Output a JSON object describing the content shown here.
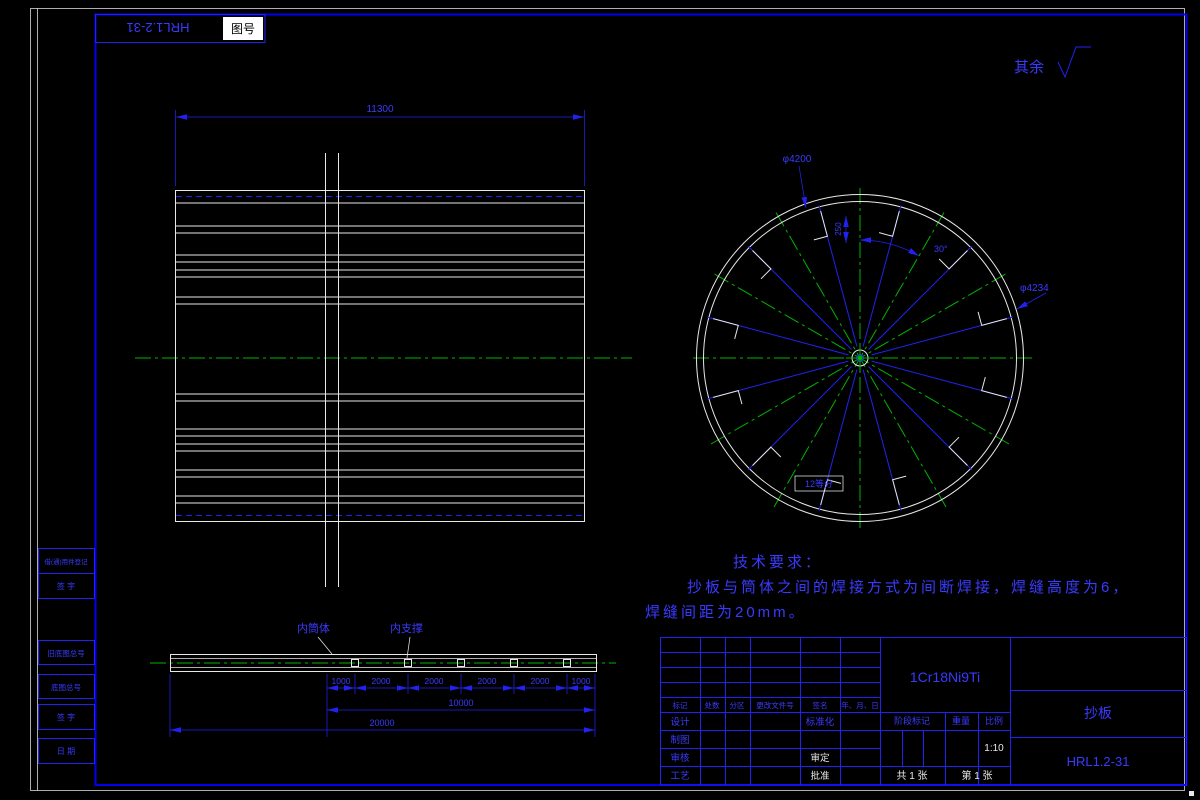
{
  "top_left": {
    "drawing_no": "HRL1.2-31",
    "box_label": "图号"
  },
  "top_right": {
    "note": "其余"
  },
  "main_view": {
    "width_dim": "11300"
  },
  "circle_view": {
    "dia_inner": "φ4200",
    "dia_outer": "φ4234",
    "angle": "30°",
    "plate_dim": "250",
    "note": "12等分"
  },
  "bottom_view": {
    "label_shell": "内筒体",
    "label_support": "内支撑",
    "seg_dims": [
      "1000",
      "2000",
      "2000",
      "2000",
      "2000",
      "1000"
    ],
    "mid_dim": "10000",
    "total_dim": "20000"
  },
  "tech_req": {
    "title": "技术要求：",
    "line1": "抄板与筒体之间的焊接方式为间断焊接，焊缝高度为6，",
    "line2": "焊缝间距为20mm。"
  },
  "title_block": {
    "material": "1Cr18Ni9Ti",
    "part_name": "抄板",
    "drawing_no": "HRL1.2-31",
    "stage_label": "阶段标记",
    "weight_label": "重量",
    "scale_label": "比例",
    "scale_value": "1:10",
    "sheet_total": "共 1 张",
    "sheet_no": "第 1 张",
    "header_cells": [
      "标记",
      "处数",
      "分区",
      "更改文件号",
      "签名",
      "年、月、日"
    ],
    "roles_left": [
      "设计",
      "制图",
      "审核",
      "工艺"
    ],
    "roles_right": [
      "标准化",
      "审定",
      "批准"
    ]
  },
  "left_strip": {
    "cells": [
      "借(通)用件登记",
      "签 字",
      "旧底图总号",
      "底图总号",
      "签 字",
      "日 期"
    ]
  },
  "colors": {
    "line_blue": "#2222f0",
    "frame_blue": "#0000ee",
    "object_white": "#e8e8e8",
    "center_green": "#00b400",
    "background": "#000000"
  }
}
